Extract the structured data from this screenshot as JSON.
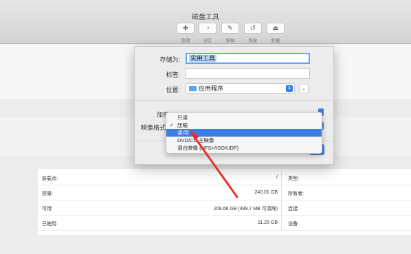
{
  "window": {
    "title": "磁盘工具"
  },
  "toolbar": {
    "buttons": [
      {
        "label": "急救",
        "icon": "stethoscope-icon",
        "glyph": "✚"
      },
      {
        "label": "分区",
        "icon": "pie-chart-icon",
        "glyph": "◔"
      },
      {
        "label": "抹掉",
        "icon": "erase-icon",
        "glyph": "✎"
      },
      {
        "label": "恢复",
        "icon": "restore-icon",
        "glyph": "↺"
      },
      {
        "label": "卸载",
        "icon": "eject-icon",
        "glyph": "⏏"
      }
    ]
  },
  "dialog": {
    "save_as_label": "存储为:",
    "save_as_value": "实用工具",
    "tags_label": "标签:",
    "tags_value": "",
    "location_label": "位置:",
    "location_value": "应用程序",
    "encryption_label": "加密",
    "format_label": "映像格式"
  },
  "format_menu": {
    "items": [
      {
        "label": "只读",
        "checked": false,
        "highlighted": false
      },
      {
        "label": "压缩",
        "checked": true,
        "highlighted": false
      },
      {
        "label": "读/写",
        "checked": false,
        "highlighted": true
      },
      {
        "label": "DVD/CD 主映像",
        "checked": false,
        "highlighted": false
      },
      {
        "label": "混合映像 (HFS+/ISO/UDF)",
        "checked": false,
        "highlighted": false
      }
    ],
    "check_glyph": "✓"
  },
  "info_table": {
    "rows": [
      {
        "label": "装载点:",
        "value": "/",
        "right_label": "类型:"
      },
      {
        "label": "容量:",
        "value": "240.01 GB",
        "right_label": "所有者:"
      },
      {
        "label": "可用:",
        "value": "208.66 GB (499.7 MB 可清除)",
        "right_label": "连接:"
      },
      {
        "label": "已使用:",
        "value": "11.25 GB",
        "right_label": "设备:"
      }
    ]
  },
  "colors": {
    "accent": "#3b7fe5",
    "arrow": "#e8302a"
  }
}
